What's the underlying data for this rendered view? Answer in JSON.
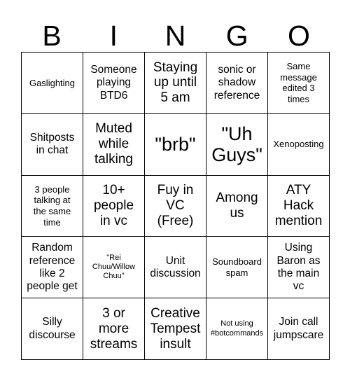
{
  "card": {
    "header_letters": [
      "B",
      "I",
      "N",
      "G",
      "O"
    ],
    "rows": [
      [
        {
          "text": "Gaslighting",
          "size": "s"
        },
        {
          "text": "Someone\nplaying\nBTD6",
          "size": "m"
        },
        {
          "text": "Staying\nup until\n5 am",
          "size": "l"
        },
        {
          "text": "sonic or\nshadow\nreference",
          "size": "m"
        },
        {
          "text": "Same\nmessage\nedited 3\ntimes",
          "size": "s"
        }
      ],
      [
        {
          "text": "Shitposts\nin chat",
          "size": "m"
        },
        {
          "text": "Muted\nwhile\ntalking",
          "size": "l"
        },
        {
          "text": "\"brb\"",
          "size": "xl"
        },
        {
          "text": "\"Uh\nGuys\"",
          "size": "xl"
        },
        {
          "text": "Xenoposting",
          "size": "s"
        }
      ],
      [
        {
          "text": "3 people\ntalking at\nthe same\ntime",
          "size": "s"
        },
        {
          "text": "10+\npeople\nin vc",
          "size": "l"
        },
        {
          "text": "Fuy in\nVC\n(Free)",
          "size": "l"
        },
        {
          "text": "Among\nus",
          "size": "l"
        },
        {
          "text": "ATY\nHack\nmention",
          "size": "l"
        }
      ],
      [
        {
          "text": "Random\nreference\nlike 2\npeople get",
          "size": "m"
        },
        {
          "text": "\"Rei\nChuu/Willow\nChuu\"",
          "size": "xs"
        },
        {
          "text": "Unit\ndiscussion",
          "size": "m"
        },
        {
          "text": "Soundboard\nspam",
          "size": "s"
        },
        {
          "text": "Using\nBaron as\nthe main\nvc",
          "size": "m"
        }
      ],
      [
        {
          "text": "Silly\ndiscourse",
          "size": "m"
        },
        {
          "text": "3 or\nmore\nstreams",
          "size": "l"
        },
        {
          "text": "Creative\nTempest\ninsult",
          "size": "l"
        },
        {
          "text": "Not using\n#botcommands",
          "size": "xs"
        },
        {
          "text": "Join call\njumpscare",
          "size": "m"
        }
      ]
    ]
  }
}
